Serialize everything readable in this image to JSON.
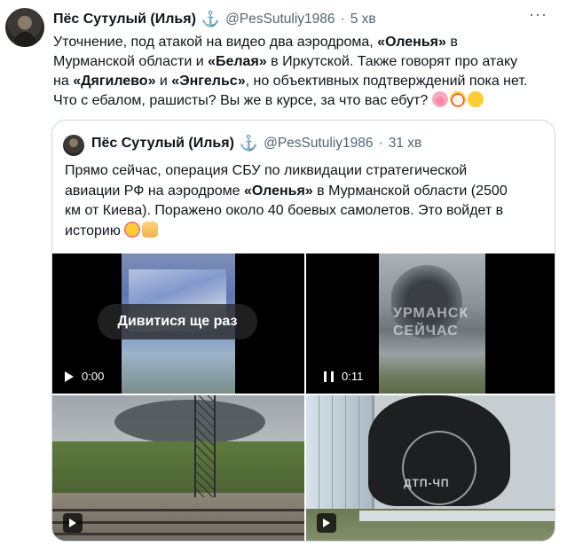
{
  "tweet": {
    "author_name": "Пёс Сутулый (Илья)",
    "verified_icon": "anchor-icon",
    "handle": "@PesSutuliy1986",
    "separator": "·",
    "time": "5 хв",
    "more_icon": "more-icon",
    "more_glyph": "···",
    "text": {
      "l1a": "Уточнение, под атакой на видео два аэродрома, ",
      "l1b": "«Оленья»",
      "l1c": " в",
      "l2a": "Мурманской области и ",
      "l2b": "«Белая»",
      "l2c": " в Иркутской. Также говорят про атаку",
      "l3a": "на ",
      "l3b": "«Дягилево»",
      "l3c": " и ",
      "l3d": "«Энгельс»",
      "l3e": ", но объективных подтверждений пока нет.",
      "l4": "Что с ебалом, рашисты? Вы же в курсе, за что вас ебут?"
    },
    "emoji": [
      "pig-face",
      "clown-face",
      "tears-of-joy"
    ]
  },
  "quoted": {
    "author_name": "Пёс Сутулый (Илья)",
    "verified_icon": "anchor-icon",
    "handle": "@PesSutuliy1986",
    "separator": "·",
    "time": "31 хв",
    "text": {
      "l1": "Прямо сейчас, операция СБУ по ликвидации стратегической",
      "l2a": "авиации РФ на аэродроме ",
      "l2b": "«Оленья»",
      "l2c": " в Мурманской области (2500",
      "l3": "км от Киева). Поражено около 40 боевых самолетов. Это войдет в",
      "l4": "историю"
    },
    "emoji": [
      "smiling-face-with-hearts",
      "thumbs-up"
    ],
    "media": {
      "video1": {
        "replay_label": "Дивитися ще раз",
        "time": "0:00",
        "state": "play"
      },
      "video2": {
        "time": "0:11",
        "state": "pause",
        "watermark": "УРМАНСК\nСЕЙЧАС"
      },
      "photo3": {
        "state": "play"
      },
      "photo4": {
        "state": "play",
        "watermark": "ДТП-ЧП"
      }
    }
  }
}
